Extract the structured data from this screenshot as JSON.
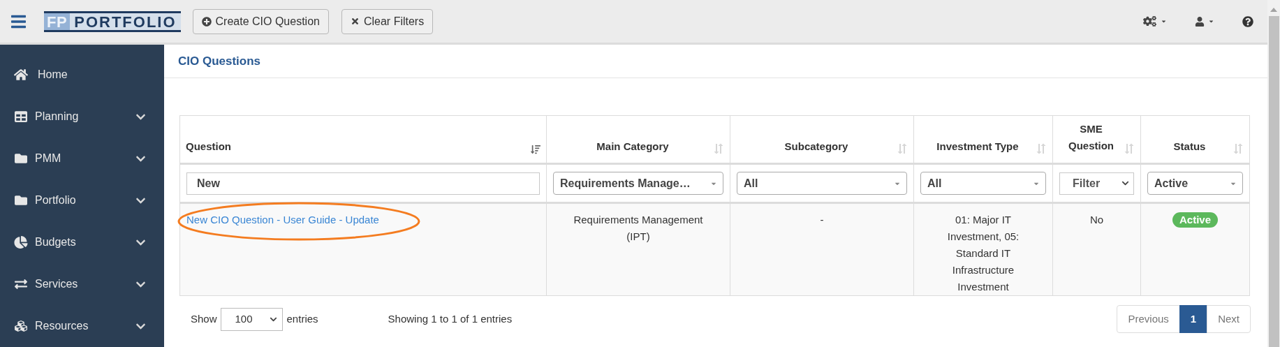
{
  "topbar": {
    "logo": {
      "prefix": "FP",
      "name": "PORTFOLIO"
    },
    "buttons": [
      {
        "kind": "create",
        "label": "Create CIO Question"
      },
      {
        "kind": "clear",
        "label": "Clear Filters"
      }
    ]
  },
  "sidebar": {
    "items": [
      {
        "label": "Home",
        "expandable": false
      },
      {
        "label": "Planning",
        "expandable": true
      },
      {
        "label": "PMM",
        "expandable": true
      },
      {
        "label": "Portfolio",
        "expandable": true
      },
      {
        "label": "Budgets",
        "expandable": true
      },
      {
        "label": "Services",
        "expandable": true
      },
      {
        "label": "Resources",
        "expandable": true
      }
    ]
  },
  "page": {
    "title": "CIO Questions"
  },
  "table": {
    "columns": [
      {
        "label": "Question",
        "sorted": true,
        "filter": {
          "kind": "text",
          "value": "New"
        }
      },
      {
        "label": "Main Category",
        "sorted": false,
        "filter": {
          "kind": "select",
          "value": "Requirements Manage…"
        }
      },
      {
        "label": "Subcategory",
        "sorted": false,
        "filter": {
          "kind": "select",
          "value": "All"
        }
      },
      {
        "label": "Investment Type",
        "sorted": false,
        "filter": {
          "kind": "select",
          "value": "All"
        }
      },
      {
        "label": "SME Question",
        "sorted": false,
        "filter": {
          "kind": "native",
          "value": "Filter"
        }
      },
      {
        "label": "Status",
        "sorted": false,
        "filter": {
          "kind": "select",
          "value": "Active"
        }
      }
    ],
    "rows": [
      {
        "circled": true,
        "question": "New CIO Question - User Guide - Update",
        "main_category": "Requirements Management (IPT)",
        "subcategory": "-",
        "investment_type": "01: Major IT Investment, 05: Standard IT Infrastructure Investment",
        "sme_question": "No",
        "status": "Active"
      }
    ]
  },
  "footer": {
    "show_label": "Show",
    "page_size": "100",
    "entries_label": "entries",
    "info": "Showing 1 to 1 of 1 entries",
    "pagination": [
      {
        "label": "Previous",
        "disabled": true,
        "selected": false
      },
      {
        "label": "1",
        "selected": true
      },
      {
        "label": "Next",
        "disabled": true,
        "selected": false
      }
    ]
  }
}
